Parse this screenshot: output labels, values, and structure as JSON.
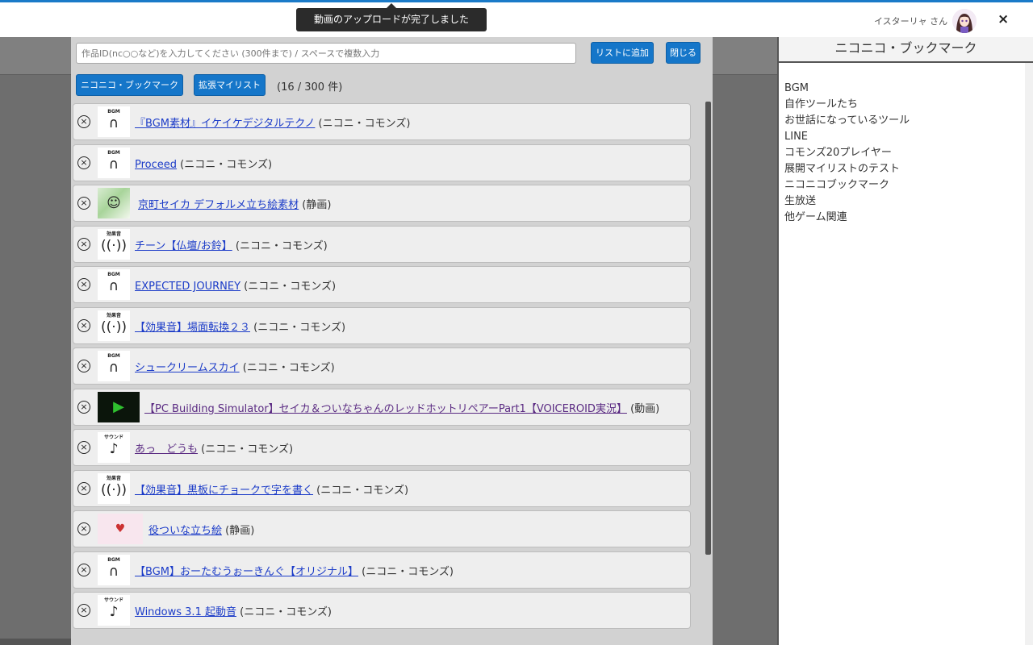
{
  "header": {
    "toast": "動画のアップロードが完了しました",
    "user_name": "イスターリャ さん",
    "close_label": "×"
  },
  "panel": {
    "input_placeholder": "作品ID(nc○○など)を入力してください (300件まで) / スペースで複数入力",
    "add_button": "リストに追加",
    "close_button": "閉じる",
    "tab_bookmark": "ニコニコ・ブックマーク",
    "tab_mylist": "拡張マイリスト",
    "count": "(16 / 300 件)"
  },
  "items": [
    {
      "thumb_label": "BGM",
      "thumb_icon": "headphones-icon",
      "thumb_glyph": "∩",
      "title": "『BGM素材』イケイケデジタルテクノ",
      "type": "(ニコニ・コモンズ)"
    },
    {
      "thumb_label": "BGM",
      "thumb_icon": "headphones-icon",
      "thumb_glyph": "∩",
      "title": "Proceed",
      "type": "(ニコニ・コモンズ)"
    },
    {
      "thumb_label": "",
      "thumb_icon": "image-thumbnail-icon",
      "thumb_glyph": "☺",
      "title": "京町セイカ デフォルメ立ち絵素材",
      "type": "(静画)"
    },
    {
      "thumb_label": "効果音",
      "thumb_icon": "sound-effect-icon",
      "thumb_glyph": "((·))",
      "title": "チーン【仏壇/お鈴】",
      "type": "(ニコニ・コモンズ)"
    },
    {
      "thumb_label": "BGM",
      "thumb_icon": "headphones-icon",
      "thumb_glyph": "∩",
      "title": "EXPECTED JOURNEY",
      "type": "(ニコニ・コモンズ)"
    },
    {
      "thumb_label": "効果音",
      "thumb_icon": "sound-effect-icon",
      "thumb_glyph": "((·))",
      "title": "【効果音】場面転換２３",
      "type": "(ニコニ・コモンズ)"
    },
    {
      "thumb_label": "BGM",
      "thumb_icon": "headphones-icon",
      "thumb_glyph": "∩",
      "title": "シュークリームスカイ",
      "type": "(ニコニ・コモンズ)"
    },
    {
      "thumb_label": "",
      "thumb_icon": "video-thumbnail-icon",
      "thumb_glyph": "▶",
      "title": "【PC Building Simulator】セイカ＆ついなちゃんのレッドホットリペアーPart1【VOICEROID実況】",
      "type": "(動画)"
    },
    {
      "thumb_label": "サウンド",
      "thumb_icon": "music-note-icon",
      "thumb_glyph": "♪",
      "title": "あっ　どうも",
      "type": "(ニコニ・コモンズ)"
    },
    {
      "thumb_label": "効果音",
      "thumb_icon": "sound-effect-icon",
      "thumb_glyph": "((·))",
      "title": "【効果音】黒板にチョークで字を書く",
      "type": "(ニコニ・コモンズ)"
    },
    {
      "thumb_label": "",
      "thumb_icon": "image-thumbnail-icon",
      "thumb_glyph": "♥",
      "title": "役ついな立ち絵",
      "type": "(静画)"
    },
    {
      "thumb_label": "BGM",
      "thumb_icon": "headphones-icon",
      "thumb_glyph": "∩",
      "title": "【BGM】おーたむうぉーきんぐ【オリジナル】",
      "type": "(ニコニ・コモンズ)"
    },
    {
      "thumb_label": "サウンド",
      "thumb_icon": "music-note-icon",
      "thumb_glyph": "♪",
      "title": "Windows 3.1 起動音",
      "type": "(ニコニ・コモンズ)"
    }
  ],
  "sidebar": {
    "title": "ニコニコ・ブックマーク",
    "folders": [
      "BGM",
      "自作ツールたち",
      "お世話になっているツール",
      "LINE",
      "コモンズ20プレイヤー",
      "展開マイリストのテスト",
      "ニコニコブックマーク",
      "生放送",
      "他ゲーム関連"
    ]
  },
  "colors": {
    "accent": "#1576c9",
    "link": "#1c3cc8",
    "visited_link": "#5a2a82"
  }
}
